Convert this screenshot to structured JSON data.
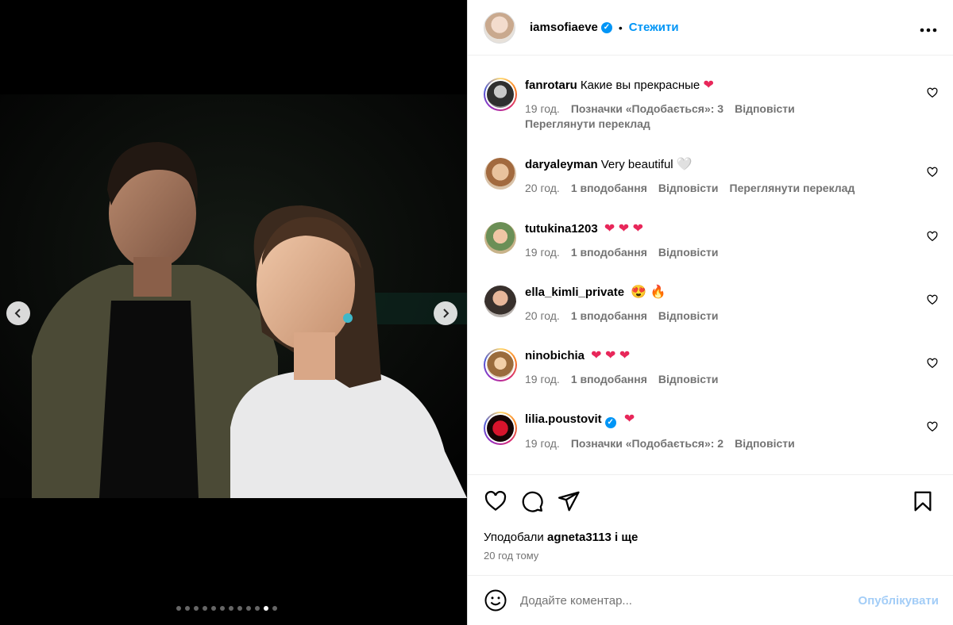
{
  "post": {
    "carousel": {
      "slide_count": 12,
      "active_index": 10
    },
    "author": {
      "username": "iamsofiaeve",
      "verified": true,
      "follow_label": "Стежити",
      "more_icon": "more-horizontal-icon"
    }
  },
  "comments": [
    {
      "username": "fanrotaru",
      "text": "Какие вы прекрасные",
      "emoji": "❤",
      "time": "19 год.",
      "likes": "Позначки «Подобається»: 3",
      "reply": "Відповісти",
      "translate": "Переглянути переклад",
      "translate_inline": "",
      "ring": true,
      "verified": false
    },
    {
      "username": "daryaleyman",
      "text": "Very beautiful",
      "emoji": "🤍",
      "time": "20 год.",
      "likes": "1 вподобання",
      "reply": "Відповісти",
      "translate": "",
      "translate_inline": "Переглянути переклад",
      "ring": false,
      "verified": false
    },
    {
      "username": "tutukina1203",
      "text": "",
      "emoji": "❤ ❤ ❤",
      "time": "19 год.",
      "likes": "1 вподобання",
      "reply": "Відповісти",
      "translate": "",
      "translate_inline": "",
      "ring": false,
      "verified": false
    },
    {
      "username": "ella_kimli_private",
      "text": "",
      "emoji": "😍 🔥",
      "time": "20 год.",
      "likes": "1 вподобання",
      "reply": "Відповісти",
      "translate": "",
      "translate_inline": "",
      "ring": false,
      "verified": false
    },
    {
      "username": "ninobichia",
      "text": "",
      "emoji": "❤ ❤ ❤",
      "time": "19 год.",
      "likes": "1 вподобання",
      "reply": "Відповісти",
      "translate": "",
      "translate_inline": "",
      "ring": true,
      "verified": false
    },
    {
      "username": "lilia.poustovit",
      "text": "",
      "emoji": "❤",
      "time": "19 год.",
      "likes": "Позначки «Подобається»: 2",
      "reply": "Відповісти",
      "translate": "",
      "translate_inline": "",
      "ring": true,
      "verified": true
    }
  ],
  "actions": {
    "liked_by_prefix": "Уподобали",
    "liked_by_user": "agneta3113",
    "liked_by_suffix": "і ще",
    "posted_time": "20 год тому"
  },
  "composer": {
    "placeholder": "Додайте коментар...",
    "publish_label": "Опублікувати"
  },
  "colors": {
    "accent": "#0095f6",
    "muted": "#737373",
    "heart": "#e8275a",
    "publish_disabled": "#a3cdf7"
  }
}
